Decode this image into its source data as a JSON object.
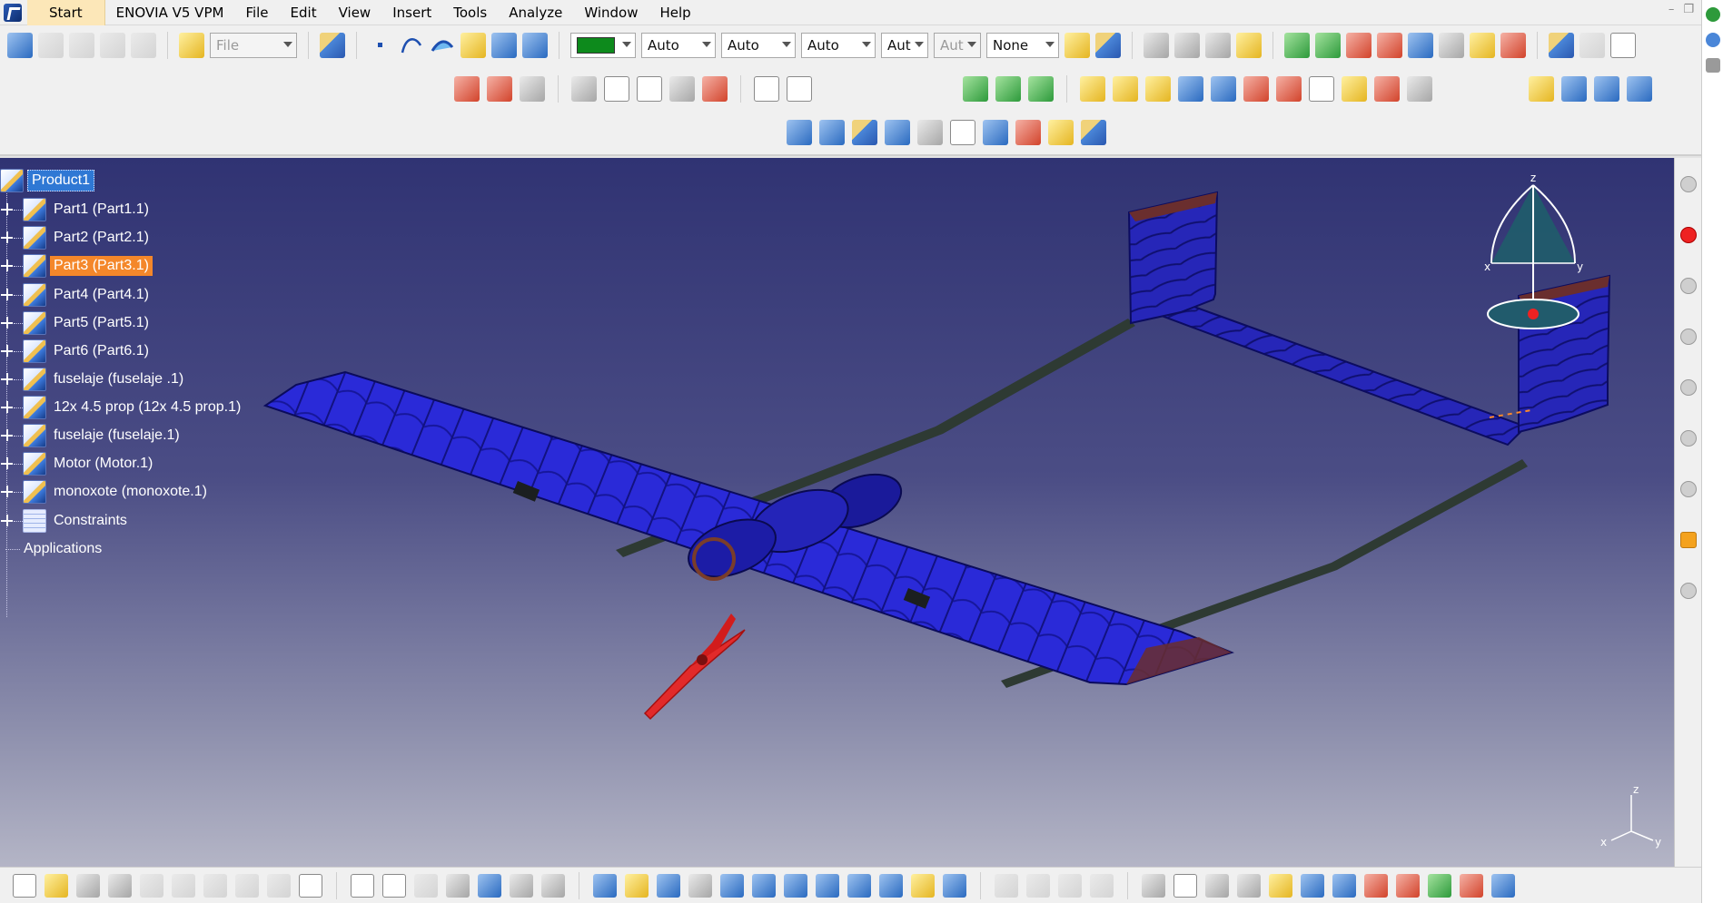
{
  "menubar": {
    "start": "Start",
    "items": [
      "ENOVIA V5 VPM",
      "File",
      "Edit",
      "View",
      "Insert",
      "Tools",
      "Analyze",
      "Window",
      "Help"
    ]
  },
  "toolbar": {
    "file_combo": "File",
    "color_combo_value": "green",
    "linetype_combo": "Auto",
    "thickness_combo": "Auto",
    "point_combo": "Auto",
    "layer_combo": "Aut",
    "layer_combo_disabled": "Aut",
    "render_combo": "None",
    "accent_color": "#0d8a1c"
  },
  "tree": {
    "root": "Product1",
    "nodes": [
      {
        "label": "Part1 (Part1.1)",
        "state": "normal"
      },
      {
        "label": "Part2 (Part2.1)",
        "state": "normal"
      },
      {
        "label": "Part3 (Part3.1)",
        "state": "highlighted"
      },
      {
        "label": "Part4 (Part4.1)",
        "state": "normal"
      },
      {
        "label": "Part5 (Part5.1)",
        "state": "normal"
      },
      {
        "label": "Part6 (Part6.1)",
        "state": "normal"
      },
      {
        "label": "fuselaje  (fuselaje .1)",
        "state": "normal"
      },
      {
        "label": "12x 4.5 prop (12x 4.5 prop.1)",
        "state": "normal"
      },
      {
        "label": "fuselaje (fuselaje.1)",
        "state": "normal"
      },
      {
        "label": "Motor (Motor.1)",
        "state": "normal"
      },
      {
        "label": "monoxote (monoxote.1)",
        "state": "normal"
      },
      {
        "label": "Constraints",
        "state": "constraints"
      }
    ],
    "applications": "Applications"
  },
  "compass": {
    "z": "z",
    "x": "x",
    "y": "y"
  },
  "axis_triad": {
    "z": "z",
    "x": "x",
    "y": "y"
  }
}
